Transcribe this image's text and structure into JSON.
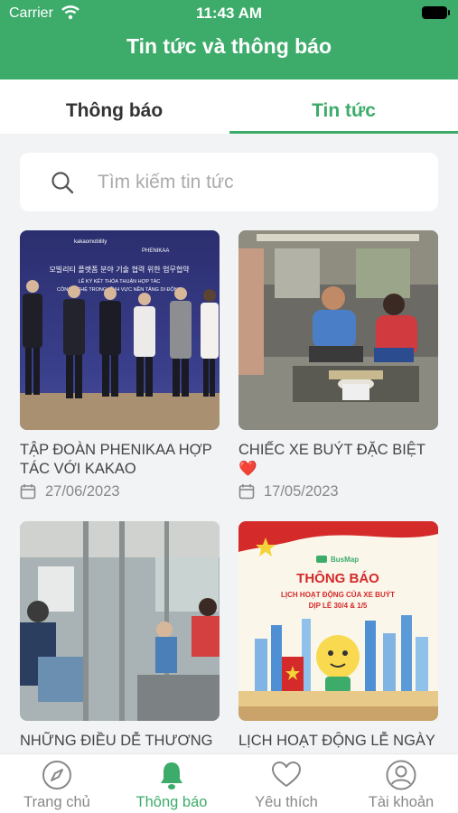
{
  "status": {
    "carrier": "Carrier",
    "time": "11:43 AM"
  },
  "header": {
    "title": "Tin tức và thông báo"
  },
  "tabs": [
    {
      "label": "Thông báo"
    },
    {
      "label": "Tin tức"
    }
  ],
  "search": {
    "placeholder": "Tìm kiếm tin tức",
    "value": ""
  },
  "news": [
    {
      "title": "TẬP ĐOÀN PHENIKAA HỢP TÁC VỚI KAKAO MOBILITY...",
      "date": "27/06/2023",
      "image": "partnership-signing-photo"
    },
    {
      "title": "CHIẾC XE BUÝT ĐẶC BIỆT ❤️",
      "date": "17/05/2023",
      "image": "bus-interior-meal-photo"
    },
    {
      "title": "NHỮNG ĐIỀU DỄ THƯƠNG",
      "date": "",
      "image": "bus-passengers-photo"
    },
    {
      "title": "LỊCH HOẠT ĐỘNG LỄ NGÀY",
      "date": "",
      "image": "busmap-holiday-poster"
    }
  ],
  "poster": {
    "brand": "BusMap",
    "heading": "THÔNG BÁO",
    "line1": "LỊCH HOẠT ĐỘNG CỦA XE BUÝT",
    "line2": "DỊP LỄ 30/4 & 1/5"
  },
  "banner": {
    "line1": "모빌리티 플랫폼 분야 기술 협력 위한 업무협약",
    "line2": "LỄ KÝ KẾT THỎA THUẬN HỢP TÁC",
    "line3": "CÔNG NGHỆ TRONG LĨNH VỰC NỀN TẢNG DI ĐỘNG",
    "logo1": "kakaomobility",
    "logo2": "PHENIKAA"
  },
  "bottom_nav": [
    {
      "label": "Trang chủ",
      "icon": "compass-icon"
    },
    {
      "label": "Thông báo",
      "icon": "bell-icon"
    },
    {
      "label": "Yêu thích",
      "icon": "heart-icon"
    },
    {
      "label": "Tài khoản",
      "icon": "user-icon"
    }
  ],
  "colors": {
    "accent": "#3dac6b",
    "muted": "#888888",
    "background": "#f2f3f5"
  }
}
